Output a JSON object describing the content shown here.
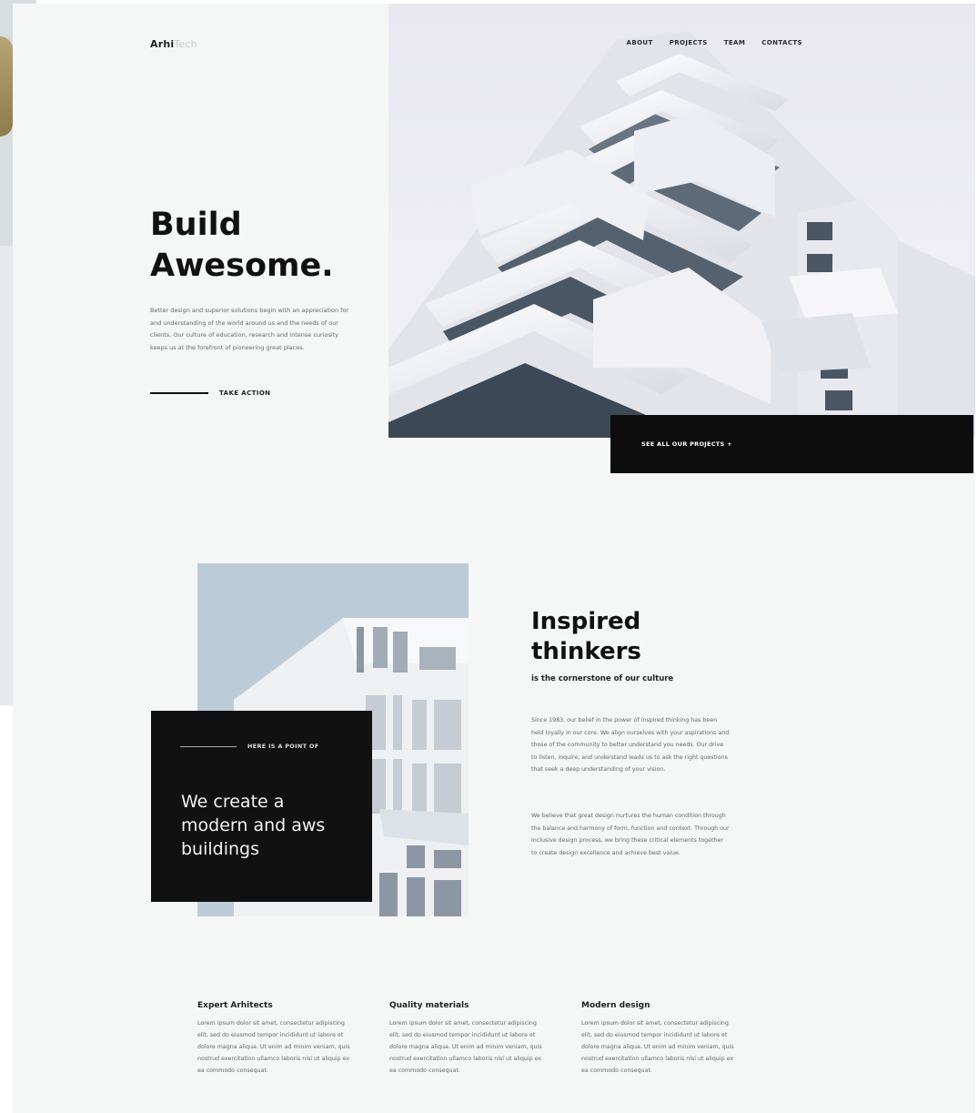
{
  "header": {
    "logo_bold": "Arhi",
    "logo_light": "Tech",
    "nav": [
      "ABOUT",
      "PROJECTS",
      "TEAM",
      "CONTACTS"
    ]
  },
  "hero": {
    "title": "Build\nAwesome.",
    "body": "Better design and superior solutions begin with an appreciation for and understanding of the world around us and the needs of our clients. Our culture of education, research and intense curiosity keeps us at the forefront of pioneering great places.",
    "cta": "TAKE ACTION",
    "projects_link": "SEE ALL OUR PROJECTS +"
  },
  "about": {
    "kicker": "HERE IS A POINT OF",
    "statement": "We create a\nmodern and aws\nbuildings",
    "title": "Inspired\nthinkers",
    "subtitle": "is the cornerstone of our culture",
    "p1": "Since 1983, our belief in the power of inspired thinking has been held loyally in our core. We align ourselves with your aspirations and those of the community to better understand you needs. Our drive to listen, inquire, and understand leads us to ask the right questions that seek a deep understanding of your vision.",
    "p2": "We believe that great design nurtures the human condition through the balance and harmony of form, function and context. Through our inclusive design process, we bring these critical elements together to create design excellence and achieve best value."
  },
  "features": [
    {
      "title": "Expert Arhitects",
      "text": "Lorem ipsum dolor sit amet, consectetur adipiscing elit, sed do eiusmod tempor incididunt ut labore et dolore magna aliqua. Ut enim ad minim veniam, quis nostrud exercitation ullamco laboris nisi ut aliquip ex ea commodo consequat."
    },
    {
      "title": "Quality materials",
      "text": "Lorem ipsum dolor sit amet, consectetur adipiscing elit, sed do eiusmod tempor incididunt ut labore et dolore magna aliqua. Ut enim ad minim veniam, quis nostrud exercitation ullamco laboris nisi ut aliquip ex ea commodo consequat."
    },
    {
      "title": "Modern design",
      "text": "Lorem ipsum dolor sit amet, consectetur adipiscing elit, sed do eiusmod tempor incididunt ut labore et dolore magna aliqua. Ut enim ad minim veniam, quis nostrud exercitation ullamco laboris nisi ut aliquip ex ea commodo consequat."
    }
  ],
  "colors": {
    "page_background": "#f5f7f7",
    "dark": "#0d0d0d",
    "text": "#111111",
    "muted_text": "#666666"
  }
}
